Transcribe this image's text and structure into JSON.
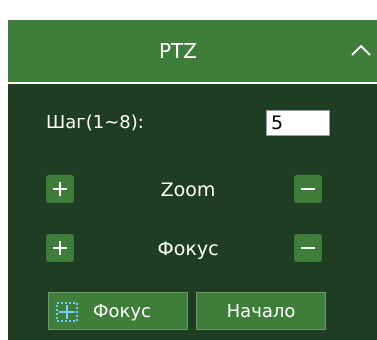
{
  "panel": {
    "title": "PTZ",
    "collapse_icon": "chevron-up-icon"
  },
  "step": {
    "label": "Шаг(1~8):",
    "value": "5"
  },
  "rows": [
    {
      "label": "Zoom",
      "plus_icon": "plus-icon",
      "minus_icon": "minus-icon"
    },
    {
      "label": "Фокус",
      "plus_icon": "plus-icon",
      "minus_icon": "minus-icon"
    }
  ],
  "buttons": {
    "focus_label": "Фокус",
    "focus_icon": "focus-target-icon",
    "start_label": "Начало"
  },
  "colors": {
    "header_bg": "#3f7d3a",
    "body_bg": "#1e3d22",
    "button_bg": "#3f7d3a",
    "text": "#ffffff"
  }
}
